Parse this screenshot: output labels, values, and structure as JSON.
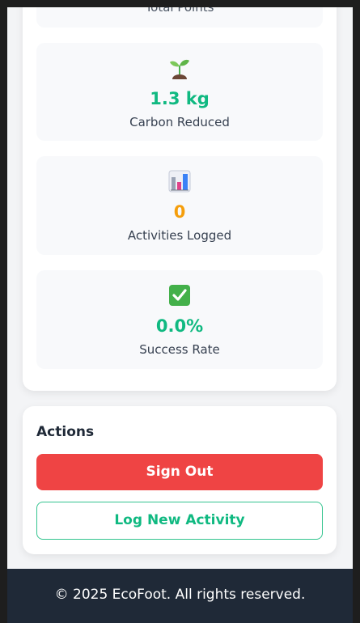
{
  "stats": {
    "total_points_label": "Total Points",
    "carbon": {
      "icon": "seedling-icon",
      "value": "1.3 kg",
      "label": "Carbon Reduced",
      "color": "#10b981"
    },
    "activities": {
      "icon": "bar-chart-icon",
      "value": "0",
      "label": "Activities Logged",
      "color": "#f59e0b"
    },
    "success": {
      "icon": "check-mark-icon",
      "value": "0.0%",
      "label": "Success Rate",
      "color": "#10b981"
    }
  },
  "actions": {
    "title": "Actions",
    "sign_out_label": "Sign Out",
    "log_activity_label": "Log New Activity",
    "danger_color": "#ef4444",
    "accent_color": "#10b981"
  },
  "footer": {
    "text": "© 2025 EcoFoot. All rights reserved."
  }
}
